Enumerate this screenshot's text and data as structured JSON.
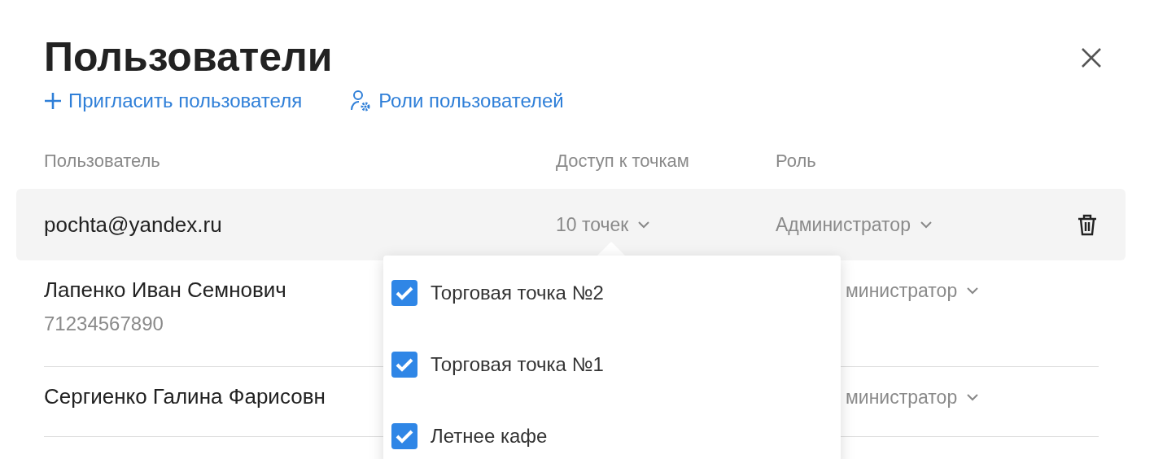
{
  "title": "Пользователи",
  "actions": [
    {
      "kind": "invite",
      "label": "Пригласить пользователя"
    },
    {
      "kind": "roles",
      "label": "Роли пользователей"
    }
  ],
  "columns": [
    "Пользователь",
    "Доступ к точкам",
    "Роль"
  ],
  "rows": [
    {
      "name": "pochta@yandex.ru",
      "access": "10 точек",
      "role": "Администратор",
      "highlighted": true,
      "role_covered": false
    },
    {
      "name": "Лапенко Иван Семнович",
      "phone": "71234567890",
      "role": "министратор",
      "highlighted": false,
      "role_covered": true
    },
    {
      "name": "Сергиенко Галина Фарисовн",
      "role": "министратор",
      "highlighted": false,
      "role_covered": true
    }
  ],
  "dropdown": {
    "items": [
      {
        "label": "Торговая точка №2",
        "checked": true
      },
      {
        "label": "Торговая точка №1",
        "checked": true
      },
      {
        "label": "Летнее кафе",
        "checked": true
      }
    ]
  }
}
